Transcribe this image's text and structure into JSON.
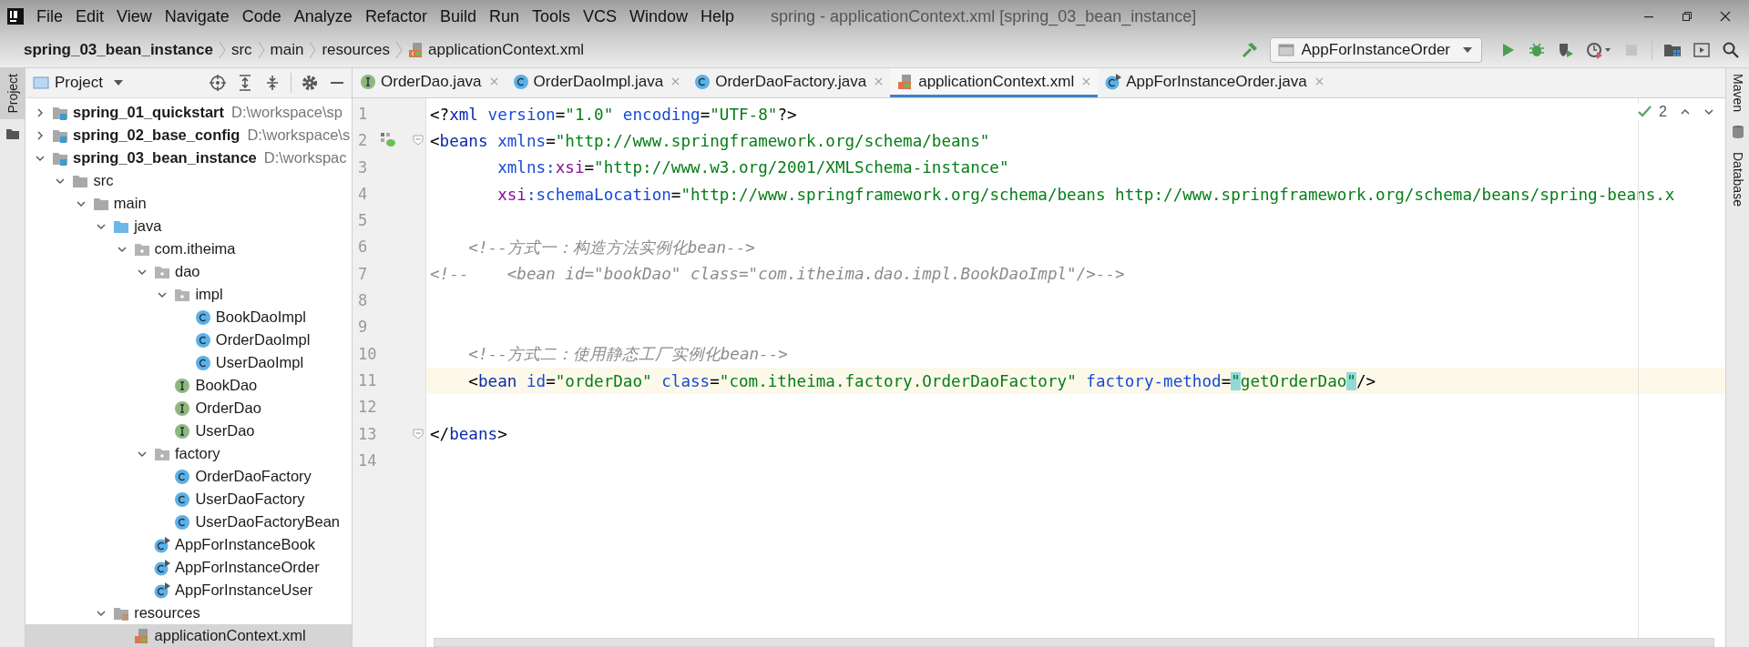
{
  "window": {
    "title": "spring - applicationContext.xml [spring_03_bean_instance]"
  },
  "menu": [
    "File",
    "Edit",
    "View",
    "Navigate",
    "Code",
    "Analyze",
    "Refactor",
    "Build",
    "Run",
    "Tools",
    "VCS",
    "Window",
    "Help"
  ],
  "breadcrumb": [
    {
      "label": "spring_03_bean_instance",
      "kind": "module"
    },
    {
      "label": "src",
      "kind": "folder"
    },
    {
      "label": "main",
      "kind": "folder"
    },
    {
      "label": "resources",
      "kind": "folder"
    },
    {
      "label": "applicationContext.xml",
      "kind": "xml"
    }
  ],
  "run_config": "AppForInstanceOrder",
  "left_stripe": [
    "Project"
  ],
  "right_stripe": [
    "Maven",
    "Database"
  ],
  "project": {
    "title": "Project",
    "tree": [
      {
        "label": "spring_01_quickstart",
        "path": "D:\\workspace\\sp",
        "kind": "module",
        "expanded": false,
        "selected": false
      },
      {
        "label": "spring_02_base_config",
        "path": "D:\\workspace\\s",
        "kind": "module",
        "expanded": false,
        "selected": false
      },
      {
        "label": "spring_03_bean_instance",
        "path": "D:\\workspac",
        "kind": "module",
        "expanded": true,
        "selected": false,
        "children": [
          {
            "label": "src",
            "kind": "folder",
            "expanded": true,
            "selected": false,
            "children": [
              {
                "label": "main",
                "kind": "folder",
                "expanded": true,
                "selected": false,
                "children": [
                  {
                    "label": "java",
                    "kind": "source",
                    "expanded": true,
                    "selected": false,
                    "children": [
                      {
                        "label": "com.itheima",
                        "kind": "package",
                        "expanded": true,
                        "selected": false,
                        "children": [
                          {
                            "label": "dao",
                            "kind": "package",
                            "expanded": true,
                            "selected": false,
                            "children": [
                              {
                                "label": "impl",
                                "kind": "package",
                                "expanded": true,
                                "selected": false,
                                "children": [
                                  {
                                    "label": "BookDaoImpl",
                                    "kind": "class",
                                    "selected": false
                                  },
                                  {
                                    "label": "OrderDaoImpl",
                                    "kind": "class",
                                    "selected": false
                                  },
                                  {
                                    "label": "UserDaoImpl",
                                    "kind": "class",
                                    "selected": false
                                  }
                                ]
                              },
                              {
                                "label": "BookDao",
                                "kind": "interface",
                                "selected": false
                              },
                              {
                                "label": "OrderDao",
                                "kind": "interface",
                                "selected": false
                              },
                              {
                                "label": "UserDao",
                                "kind": "interface",
                                "selected": false
                              }
                            ]
                          },
                          {
                            "label": "factory",
                            "kind": "package",
                            "expanded": true,
                            "selected": false,
                            "children": [
                              {
                                "label": "OrderDaoFactory",
                                "kind": "class",
                                "selected": false
                              },
                              {
                                "label": "UserDaoFactory",
                                "kind": "class",
                                "selected": false
                              },
                              {
                                "label": "UserDaoFactoryBean",
                                "kind": "class",
                                "selected": false
                              }
                            ]
                          },
                          {
                            "label": "AppForInstanceBook",
                            "kind": "runnable",
                            "selected": false
                          },
                          {
                            "label": "AppForInstanceOrder",
                            "kind": "runnable",
                            "selected": false
                          },
                          {
                            "label": "AppForInstanceUser",
                            "kind": "runnable",
                            "selected": false
                          }
                        ]
                      }
                    ]
                  },
                  {
                    "label": "resources",
                    "kind": "resources",
                    "expanded": true,
                    "selected": false,
                    "children": [
                      {
                        "label": "applicationContext.xml",
                        "kind": "xml",
                        "selected": true
                      }
                    ]
                  }
                ]
              }
            ]
          }
        ]
      }
    ]
  },
  "tabs": [
    {
      "label": "OrderDao.java",
      "kind": "interface",
      "selected": false
    },
    {
      "label": "OrderDaoImpl.java",
      "kind": "class",
      "selected": false
    },
    {
      "label": "OrderDaoFactory.java",
      "kind": "class",
      "selected": false
    },
    {
      "label": "applicationContext.xml",
      "kind": "xml",
      "selected": true
    },
    {
      "label": "AppForInstanceOrder.java",
      "kind": "runnable",
      "selected": false
    }
  ],
  "inspection": {
    "count": "2"
  },
  "editor": {
    "lines": [
      {
        "number": "1",
        "current": false,
        "tokens": [
          {
            "text": "<?",
            "kind": "plain"
          },
          {
            "text": "xml",
            "kind": "tag"
          },
          {
            "text": " version",
            "kind": "attr"
          },
          {
            "text": "=",
            "kind": "plain"
          },
          {
            "text": "\"1.0\"",
            "kind": "value"
          },
          {
            "text": " encoding",
            "kind": "attr"
          },
          {
            "text": "=",
            "kind": "plain"
          },
          {
            "text": "\"UTF-8\"",
            "kind": "value"
          },
          {
            "text": "?>",
            "kind": "plain"
          }
        ]
      },
      {
        "number": "2",
        "current": false,
        "gutter_icon": true,
        "fold": true,
        "tokens": [
          {
            "text": "<",
            "kind": "plain"
          },
          {
            "text": "beans",
            "kind": "tag"
          },
          {
            "text": " xmlns",
            "kind": "attr"
          },
          {
            "text": "=",
            "kind": "plain"
          },
          {
            "text": "\"http://www.springframework.org/schema/beans\"",
            "kind": "value"
          }
        ]
      },
      {
        "number": "3",
        "current": false,
        "tokens": [
          {
            "text": "       xmlns:",
            "kind": "attr"
          },
          {
            "text": "xsi",
            "kind": "ns"
          },
          {
            "text": "=",
            "kind": "plain"
          },
          {
            "text": "\"http://www.w3.org/2001/XMLSchema-instance\"",
            "kind": "value"
          }
        ]
      },
      {
        "number": "4",
        "current": false,
        "tokens": [
          {
            "text": "       xsi",
            "kind": "ns"
          },
          {
            "text": ":schemaLocation",
            "kind": "attr"
          },
          {
            "text": "=",
            "kind": "plain"
          },
          {
            "text": "\"http://www.springframework.org/schema/beans http://www.springframework.org/schema/beans/spring-beans.x",
            "kind": "value"
          }
        ]
      },
      {
        "number": "5",
        "current": false
      },
      {
        "number": "6",
        "current": false,
        "tokens": [
          {
            "text": "    <!--方式一：构造方法实例化bean-->",
            "kind": "comment"
          }
        ]
      },
      {
        "number": "7",
        "current": false,
        "tokens": [
          {
            "text": "<!--    <bean id=\"bookDao\" class=\"com.itheima.dao.impl.BookDaoImpl\"/>-->",
            "kind": "comment"
          }
        ]
      },
      {
        "number": "8",
        "current": false
      },
      {
        "number": "9",
        "current": false
      },
      {
        "number": "10",
        "current": false,
        "tokens": [
          {
            "text": "    <!--方式二：使用静态工厂实例化bean-->",
            "kind": "comment"
          }
        ]
      },
      {
        "number": "11",
        "current": true,
        "tokens": [
          {
            "text": "    <",
            "kind": "plain"
          },
          {
            "text": "bean",
            "kind": "tag"
          },
          {
            "text": " id",
            "kind": "attr"
          },
          {
            "text": "=",
            "kind": "plain"
          },
          {
            "text": "\"orderDao\"",
            "kind": "value"
          },
          {
            "text": " class",
            "kind": "attr"
          },
          {
            "text": "=",
            "kind": "plain"
          },
          {
            "text": "\"com.itheima.factory.OrderDaoFactory\"",
            "kind": "value"
          },
          {
            "text": " factory-method",
            "kind": "attr"
          },
          {
            "text": "=",
            "kind": "plain"
          },
          {
            "text": "\"",
            "kind": "match"
          },
          {
            "text": "getOrderDao",
            "kind": "value"
          },
          {
            "text": "\"",
            "kind": "match"
          },
          {
            "text": "/>",
            "kind": "plain"
          }
        ]
      },
      {
        "number": "12",
        "current": false
      },
      {
        "number": "13",
        "current": false,
        "fold": true,
        "tokens": [
          {
            "text": "</",
            "kind": "plain"
          },
          {
            "text": "beans",
            "kind": "tag"
          },
          {
            "text": ">",
            "kind": "plain"
          }
        ]
      },
      {
        "number": "14",
        "current": false
      }
    ]
  }
}
